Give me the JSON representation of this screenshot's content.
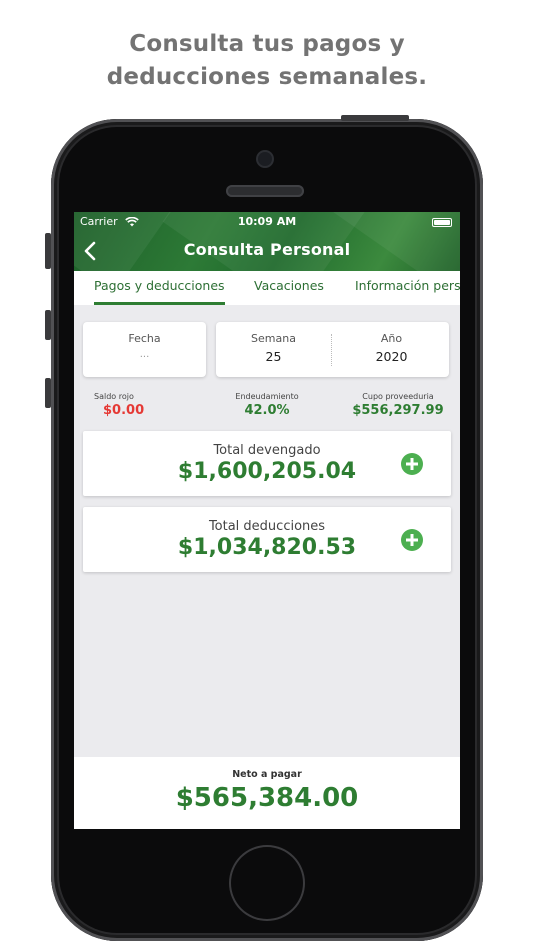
{
  "headline": {
    "line1": "Consulta tus pagos y",
    "line2": "deducciones semanales."
  },
  "status_bar": {
    "carrier": "Carrier",
    "time": "10:09 AM"
  },
  "nav": {
    "title": "Consulta Personal",
    "back_icon": "chevron-left-icon"
  },
  "tabs": [
    {
      "label": "Pagos y deducciones",
      "active": true
    },
    {
      "label": "Vacaciones",
      "active": false
    },
    {
      "label": "Información personal",
      "active": false
    }
  ],
  "filters": {
    "fecha": {
      "label": "Fecha",
      "value": "..."
    },
    "semana": {
      "label": "Semana",
      "value": "25"
    },
    "anio": {
      "label": "Año",
      "value": "2020"
    }
  },
  "stats": [
    {
      "label": "Saldo rojo",
      "value": "$0.00",
      "color": "#e53935"
    },
    {
      "label": "Endeudamiento",
      "value": "42.0%",
      "color": "#2e7d32"
    },
    {
      "label": "Cupo  proveeduria",
      "value": "$556,297.99",
      "color": "#2e7d32"
    }
  ],
  "totals": {
    "devengado": {
      "label": "Total devengado",
      "amount": "$1,600,205.04",
      "icon": "plus-circle-icon"
    },
    "deducciones": {
      "label": "Total deducciones",
      "amount": "$1,034,820.53",
      "icon": "plus-circle-icon"
    }
  },
  "footer": {
    "label": "Neto a pagar",
    "amount": "$565,384.00"
  },
  "colors": {
    "accent": "#2e7d32",
    "header": "#1f6a2c",
    "negative": "#e53935"
  }
}
